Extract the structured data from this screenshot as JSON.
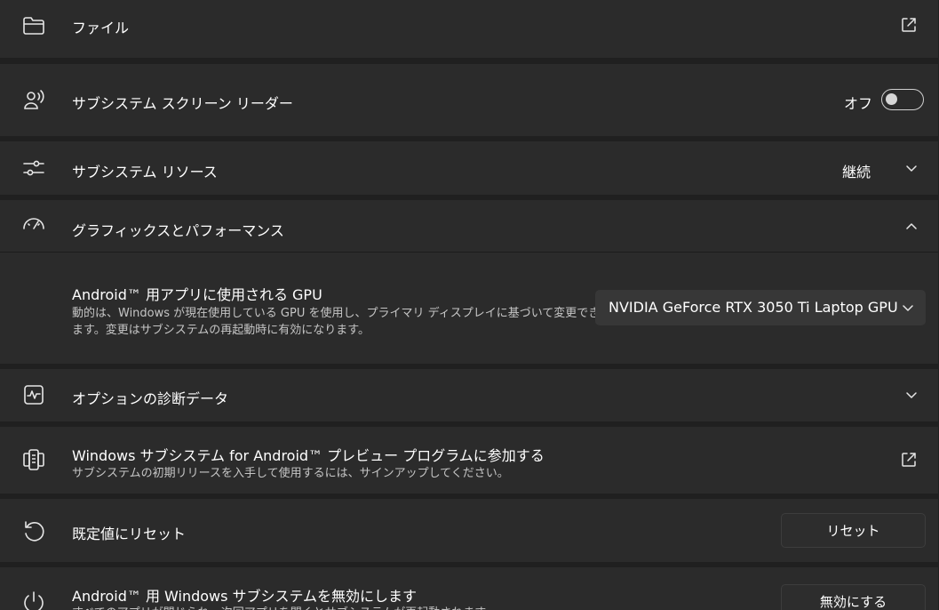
{
  "file": {
    "title": "ファイル"
  },
  "screen_reader": {
    "title": "サブシステム スクリーン リーダー",
    "state_label": "オフ",
    "enabled": false
  },
  "resources": {
    "title": "サブシステム リソース",
    "value": "継続"
  },
  "graphics": {
    "title": "グラフィックスとパフォーマンス",
    "gpu": {
      "title": "Android™ 用アプリに使用される GPU",
      "desc_line1": "動的は、Windows が現在使用している GPU を使用し、プライマリ ディスプレイに基づいて変更でき",
      "desc_line2": "ます。変更はサブシステムの再起動時に有効になります。",
      "selected": "NVIDIA GeForce RTX 3050 Ti Laptop GPU"
    }
  },
  "diagnostics": {
    "title": "オプションの診断データ"
  },
  "preview": {
    "title": "Windows サブシステム for Android™ プレビュー プログラムに参加する",
    "desc": "サブシステムの初期リリースを入手して使用するには、サインアップしてください。"
  },
  "reset": {
    "title": "既定値にリセット",
    "button": "リセット"
  },
  "disable": {
    "title": "Android™ 用 Windows サブシステムを無効にします",
    "desc": "すべてのアプリが閉じられ、次回アプリを開くとサブシステムが再起動されます",
    "button": "無効にする"
  }
}
